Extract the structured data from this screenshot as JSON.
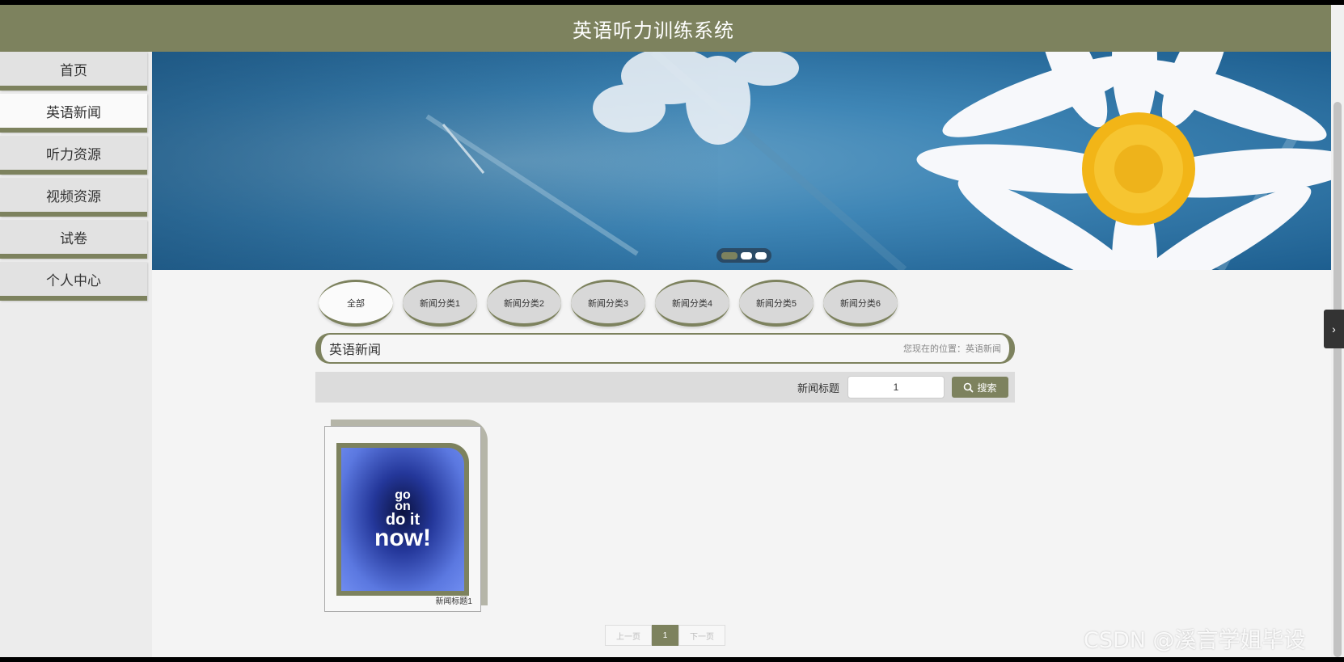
{
  "header": {
    "title": "英语听力训练系统"
  },
  "sidebar": {
    "items": [
      {
        "label": "首页"
      },
      {
        "label": "英语新闻"
      },
      {
        "label": "听力资源"
      },
      {
        "label": "视频资源"
      },
      {
        "label": "试卷"
      },
      {
        "label": "个人中心"
      }
    ],
    "active": "英语新闻"
  },
  "categories": [
    {
      "label": "全部"
    },
    {
      "label": "新闻分类1"
    },
    {
      "label": "新闻分类2"
    },
    {
      "label": "新闻分类3"
    },
    {
      "label": "新闻分类4"
    },
    {
      "label": "新闻分类5"
    },
    {
      "label": "新闻分类6"
    }
  ],
  "section": {
    "title": "英语新闻",
    "location": "您现在的位置：英语新闻"
  },
  "search": {
    "label": "新闻标题",
    "value": "1",
    "button": "搜索"
  },
  "news": [
    {
      "title": "新闻标题1",
      "image_text": [
        "go",
        "on",
        "do it",
        "now!"
      ]
    }
  ],
  "pagination": {
    "prev": "上一页",
    "current": "1",
    "next": "下一页"
  },
  "watermark": "CSDN @溪言学姐毕设",
  "colors": {
    "accent": "#7d825e"
  }
}
